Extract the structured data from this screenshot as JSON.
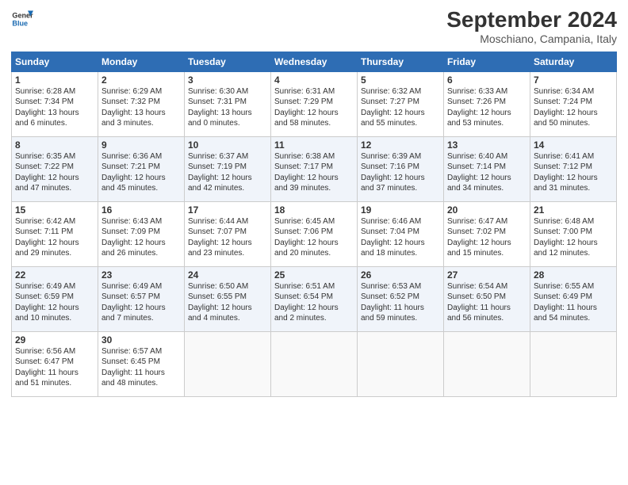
{
  "header": {
    "logo_line1": "General",
    "logo_line2": "Blue",
    "month": "September 2024",
    "location": "Moschiano, Campania, Italy"
  },
  "weekdays": [
    "Sunday",
    "Monday",
    "Tuesday",
    "Wednesday",
    "Thursday",
    "Friday",
    "Saturday"
  ],
  "weeks": [
    [
      {
        "day": "1",
        "text": "Sunrise: 6:28 AM\nSunset: 7:34 PM\nDaylight: 13 hours\nand 6 minutes."
      },
      {
        "day": "2",
        "text": "Sunrise: 6:29 AM\nSunset: 7:32 PM\nDaylight: 13 hours\nand 3 minutes."
      },
      {
        "day": "3",
        "text": "Sunrise: 6:30 AM\nSunset: 7:31 PM\nDaylight: 13 hours\nand 0 minutes."
      },
      {
        "day": "4",
        "text": "Sunrise: 6:31 AM\nSunset: 7:29 PM\nDaylight: 12 hours\nand 58 minutes."
      },
      {
        "day": "5",
        "text": "Sunrise: 6:32 AM\nSunset: 7:27 PM\nDaylight: 12 hours\nand 55 minutes."
      },
      {
        "day": "6",
        "text": "Sunrise: 6:33 AM\nSunset: 7:26 PM\nDaylight: 12 hours\nand 53 minutes."
      },
      {
        "day": "7",
        "text": "Sunrise: 6:34 AM\nSunset: 7:24 PM\nDaylight: 12 hours\nand 50 minutes."
      }
    ],
    [
      {
        "day": "8",
        "text": "Sunrise: 6:35 AM\nSunset: 7:22 PM\nDaylight: 12 hours\nand 47 minutes."
      },
      {
        "day": "9",
        "text": "Sunrise: 6:36 AM\nSunset: 7:21 PM\nDaylight: 12 hours\nand 45 minutes."
      },
      {
        "day": "10",
        "text": "Sunrise: 6:37 AM\nSunset: 7:19 PM\nDaylight: 12 hours\nand 42 minutes."
      },
      {
        "day": "11",
        "text": "Sunrise: 6:38 AM\nSunset: 7:17 PM\nDaylight: 12 hours\nand 39 minutes."
      },
      {
        "day": "12",
        "text": "Sunrise: 6:39 AM\nSunset: 7:16 PM\nDaylight: 12 hours\nand 37 minutes."
      },
      {
        "day": "13",
        "text": "Sunrise: 6:40 AM\nSunset: 7:14 PM\nDaylight: 12 hours\nand 34 minutes."
      },
      {
        "day": "14",
        "text": "Sunrise: 6:41 AM\nSunset: 7:12 PM\nDaylight: 12 hours\nand 31 minutes."
      }
    ],
    [
      {
        "day": "15",
        "text": "Sunrise: 6:42 AM\nSunset: 7:11 PM\nDaylight: 12 hours\nand 29 minutes."
      },
      {
        "day": "16",
        "text": "Sunrise: 6:43 AM\nSunset: 7:09 PM\nDaylight: 12 hours\nand 26 minutes."
      },
      {
        "day": "17",
        "text": "Sunrise: 6:44 AM\nSunset: 7:07 PM\nDaylight: 12 hours\nand 23 minutes."
      },
      {
        "day": "18",
        "text": "Sunrise: 6:45 AM\nSunset: 7:06 PM\nDaylight: 12 hours\nand 20 minutes."
      },
      {
        "day": "19",
        "text": "Sunrise: 6:46 AM\nSunset: 7:04 PM\nDaylight: 12 hours\nand 18 minutes."
      },
      {
        "day": "20",
        "text": "Sunrise: 6:47 AM\nSunset: 7:02 PM\nDaylight: 12 hours\nand 15 minutes."
      },
      {
        "day": "21",
        "text": "Sunrise: 6:48 AM\nSunset: 7:00 PM\nDaylight: 12 hours\nand 12 minutes."
      }
    ],
    [
      {
        "day": "22",
        "text": "Sunrise: 6:49 AM\nSunset: 6:59 PM\nDaylight: 12 hours\nand 10 minutes."
      },
      {
        "day": "23",
        "text": "Sunrise: 6:49 AM\nSunset: 6:57 PM\nDaylight: 12 hours\nand 7 minutes."
      },
      {
        "day": "24",
        "text": "Sunrise: 6:50 AM\nSunset: 6:55 PM\nDaylight: 12 hours\nand 4 minutes."
      },
      {
        "day": "25",
        "text": "Sunrise: 6:51 AM\nSunset: 6:54 PM\nDaylight: 12 hours\nand 2 minutes."
      },
      {
        "day": "26",
        "text": "Sunrise: 6:53 AM\nSunset: 6:52 PM\nDaylight: 11 hours\nand 59 minutes."
      },
      {
        "day": "27",
        "text": "Sunrise: 6:54 AM\nSunset: 6:50 PM\nDaylight: 11 hours\nand 56 minutes."
      },
      {
        "day": "28",
        "text": "Sunrise: 6:55 AM\nSunset: 6:49 PM\nDaylight: 11 hours\nand 54 minutes."
      }
    ],
    [
      {
        "day": "29",
        "text": "Sunrise: 6:56 AM\nSunset: 6:47 PM\nDaylight: 11 hours\nand 51 minutes."
      },
      {
        "day": "30",
        "text": "Sunrise: 6:57 AM\nSunset: 6:45 PM\nDaylight: 11 hours\nand 48 minutes."
      },
      {
        "day": "",
        "text": ""
      },
      {
        "day": "",
        "text": ""
      },
      {
        "day": "",
        "text": ""
      },
      {
        "day": "",
        "text": ""
      },
      {
        "day": "",
        "text": ""
      }
    ]
  ]
}
